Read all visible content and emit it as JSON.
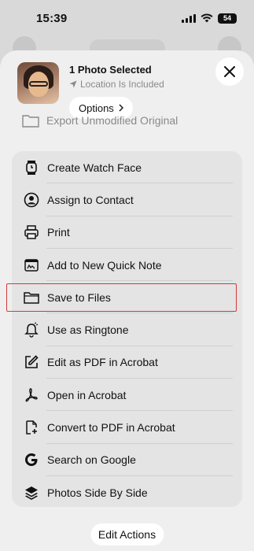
{
  "status_bar": {
    "time": "15:39",
    "battery": "54"
  },
  "header": {
    "title": "1 Photo Selected",
    "location": "Location Is Included",
    "options_label": "Options"
  },
  "export_row": {
    "label": "Export Unmodified Original"
  },
  "actions": [
    {
      "label": "Create Watch Face",
      "icon": "watch-icon"
    },
    {
      "label": "Assign to Contact",
      "icon": "contact-icon"
    },
    {
      "label": "Print",
      "icon": "printer-icon"
    },
    {
      "label": "Add to New Quick Note",
      "icon": "quick-note-icon"
    },
    {
      "label": "Save to Files",
      "icon": "folder-icon"
    },
    {
      "label": "Use as Ringtone",
      "icon": "bell-icon"
    },
    {
      "label": "Edit as PDF in Acrobat",
      "icon": "edit-pdf-icon"
    },
    {
      "label": "Open in Acrobat",
      "icon": "acrobat-icon"
    },
    {
      "label": "Convert to PDF in Acrobat",
      "icon": "convert-pdf-icon"
    },
    {
      "label": "Search on Google",
      "icon": "google-icon"
    },
    {
      "label": "Photos Side By Side",
      "icon": "layers-icon"
    }
  ],
  "edit_actions_label": "Edit Actions",
  "colors": {
    "highlight": "#d23a3a",
    "sheet": "#efefef",
    "list": "#e4e4e4"
  }
}
